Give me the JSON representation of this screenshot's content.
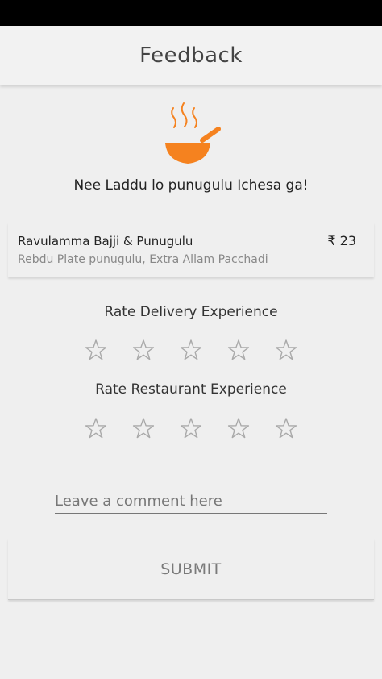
{
  "header": {
    "title": "Feedback"
  },
  "hero": {
    "icon": "bowl-icon",
    "accent_color": "#f5821f",
    "tagline": "Nee Laddu lo punugulu Ichesa ga!"
  },
  "order": {
    "item_name": "Ravulamma Bajji & Punugulu",
    "price": "₹ 23",
    "description": "Rebdu Plate punugulu, Extra Allam Pacchadi"
  },
  "ratings": [
    {
      "title": "Rate Delivery Experience",
      "max_stars": 5,
      "selected": 0
    },
    {
      "title": "Rate Restaurant Experience",
      "max_stars": 5,
      "selected": 0
    }
  ],
  "comment": {
    "placeholder": "Leave a comment here",
    "value": ""
  },
  "submit": {
    "label": "SUBMIT"
  },
  "colors": {
    "star_outline": "#a9a9a9",
    "status_bar": "#000000"
  }
}
